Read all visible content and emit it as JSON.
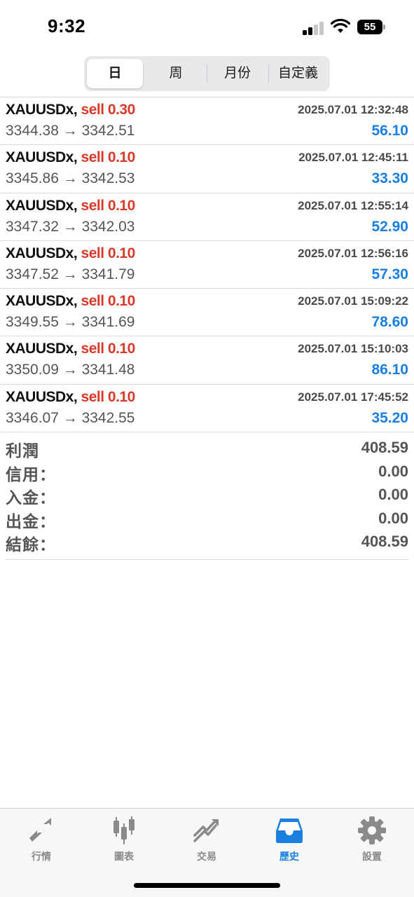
{
  "status_bar": {
    "time": "9:32",
    "battery": "55"
  },
  "segments": [
    {
      "label": "日",
      "active": true
    },
    {
      "label": "周",
      "active": false
    },
    {
      "label": "月份",
      "active": false
    },
    {
      "label": "自定義",
      "active": false
    }
  ],
  "trades": [
    {
      "symbol": "XAUUSDx,",
      "side": "sell 0.30",
      "time": "2025.07.01 12:32:48",
      "prices": "3344.38 → 3342.51",
      "profit": "56.10"
    },
    {
      "symbol": "XAUUSDx,",
      "side": "sell 0.10",
      "time": "2025.07.01 12:45:11",
      "prices": "3345.86 → 3342.53",
      "profit": "33.30"
    },
    {
      "symbol": "XAUUSDx,",
      "side": "sell 0.10",
      "time": "2025.07.01 12:55:14",
      "prices": "3347.32 → 3342.03",
      "profit": "52.90"
    },
    {
      "symbol": "XAUUSDx,",
      "side": "sell 0.10",
      "time": "2025.07.01 12:56:16",
      "prices": "3347.52 → 3341.79",
      "profit": "57.30"
    },
    {
      "symbol": "XAUUSDx,",
      "side": "sell 0.10",
      "time": "2025.07.01 15:09:22",
      "prices": "3349.55 → 3341.69",
      "profit": "78.60"
    },
    {
      "symbol": "XAUUSDx,",
      "side": "sell 0.10",
      "time": "2025.07.01 15:10:03",
      "prices": "3350.09 → 3341.48",
      "profit": "86.10"
    },
    {
      "symbol": "XAUUSDx,",
      "side": "sell 0.10",
      "time": "2025.07.01 17:45:52",
      "prices": "3346.07 → 3342.55",
      "profit": "35.20"
    }
  ],
  "summary": [
    {
      "label": "利潤",
      "value": "408.59"
    },
    {
      "label": "信用：",
      "value": "0.00"
    },
    {
      "label": "入金：",
      "value": "0.00"
    },
    {
      "label": "出金：",
      "value": "0.00"
    },
    {
      "label": "結餘：",
      "value": "408.59"
    }
  ],
  "tabs": [
    {
      "label": "行情",
      "icon": "quotes-icon",
      "active": false
    },
    {
      "label": "圖表",
      "icon": "chart-icon",
      "active": false
    },
    {
      "label": "交易",
      "icon": "trade-icon",
      "active": false
    },
    {
      "label": "歷史",
      "icon": "history-icon",
      "active": true
    },
    {
      "label": "設置",
      "icon": "settings-icon",
      "active": false
    }
  ],
  "colors": {
    "sell": "#d93a2a",
    "profit": "#1a7fe0",
    "tab_active": "#1a7fe0",
    "tab_inactive": "#8a8a8a"
  }
}
